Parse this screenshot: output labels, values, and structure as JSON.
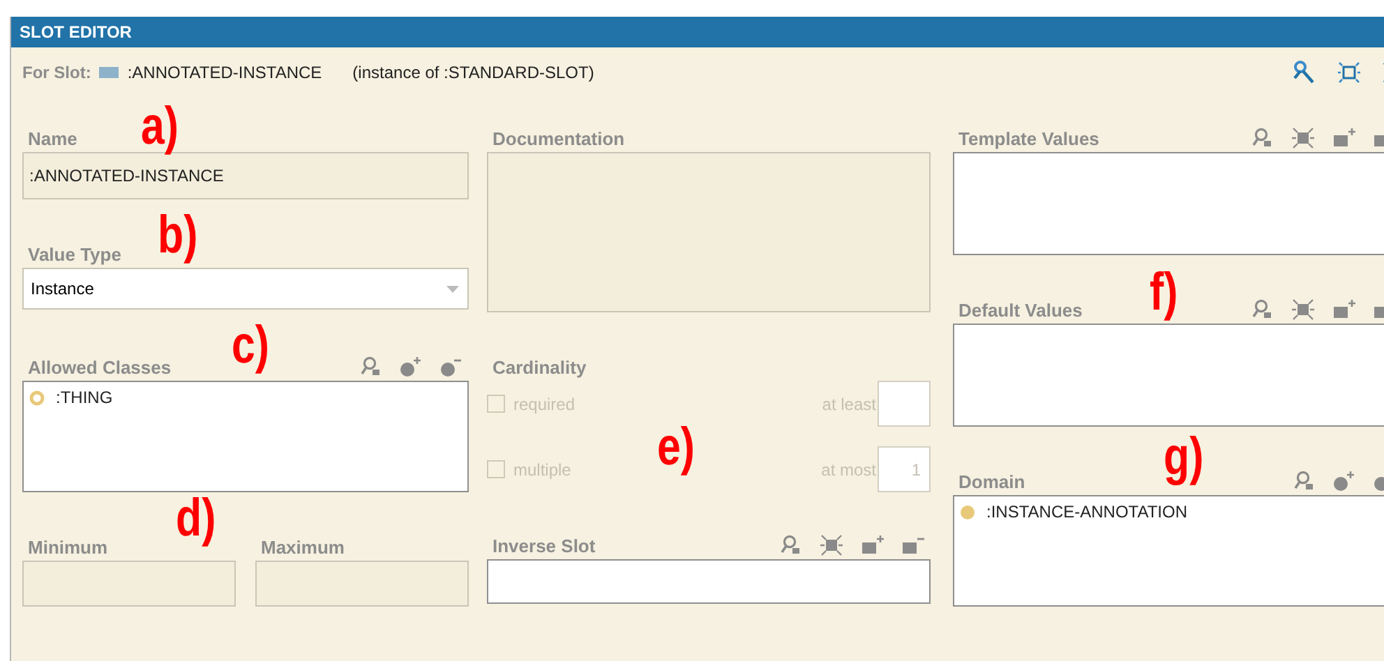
{
  "window": {
    "title": "SLOT EDITOR"
  },
  "header": {
    "label": "For Slot:",
    "slot_name": ":ANNOTATED-INSTANCE",
    "instance_of": "(instance of :STANDARD-SLOT)"
  },
  "name": {
    "label": "Name",
    "value": ":ANNOTATED-INSTANCE",
    "disabled": true,
    "annotation": "a)"
  },
  "value_type": {
    "label": "Value Type",
    "value": "Instance",
    "annotation": "b)"
  },
  "allowed_classes": {
    "label": "Allowed Classes",
    "annotation": "c)",
    "items": [
      {
        "name": ":THING",
        "kind": "ring"
      }
    ]
  },
  "minimum": {
    "label": "Minimum",
    "disabled": true,
    "annotation": "d)"
  },
  "maximum": {
    "label": "Maximum",
    "disabled": true
  },
  "documentation": {
    "label": "Documentation",
    "disabled": true
  },
  "cardinality": {
    "label": "Cardinality",
    "annotation": "e)",
    "disabled": true,
    "required": {
      "label": "required",
      "checked": false
    },
    "multiple": {
      "label": "multiple",
      "checked": false
    },
    "at_least": {
      "label": "at least"
    },
    "at_most": {
      "label": "at most",
      "value": "1"
    }
  },
  "inverse_slot": {
    "label": "Inverse Slot"
  },
  "template_values": {
    "label": "Template Values"
  },
  "default_values": {
    "label": "Default Values",
    "annotation": "f)"
  },
  "domain": {
    "label": "Domain",
    "annotation": "g)",
    "items": [
      {
        "name": ":INSTANCE-ANNOTATION",
        "kind": "dot"
      }
    ]
  }
}
